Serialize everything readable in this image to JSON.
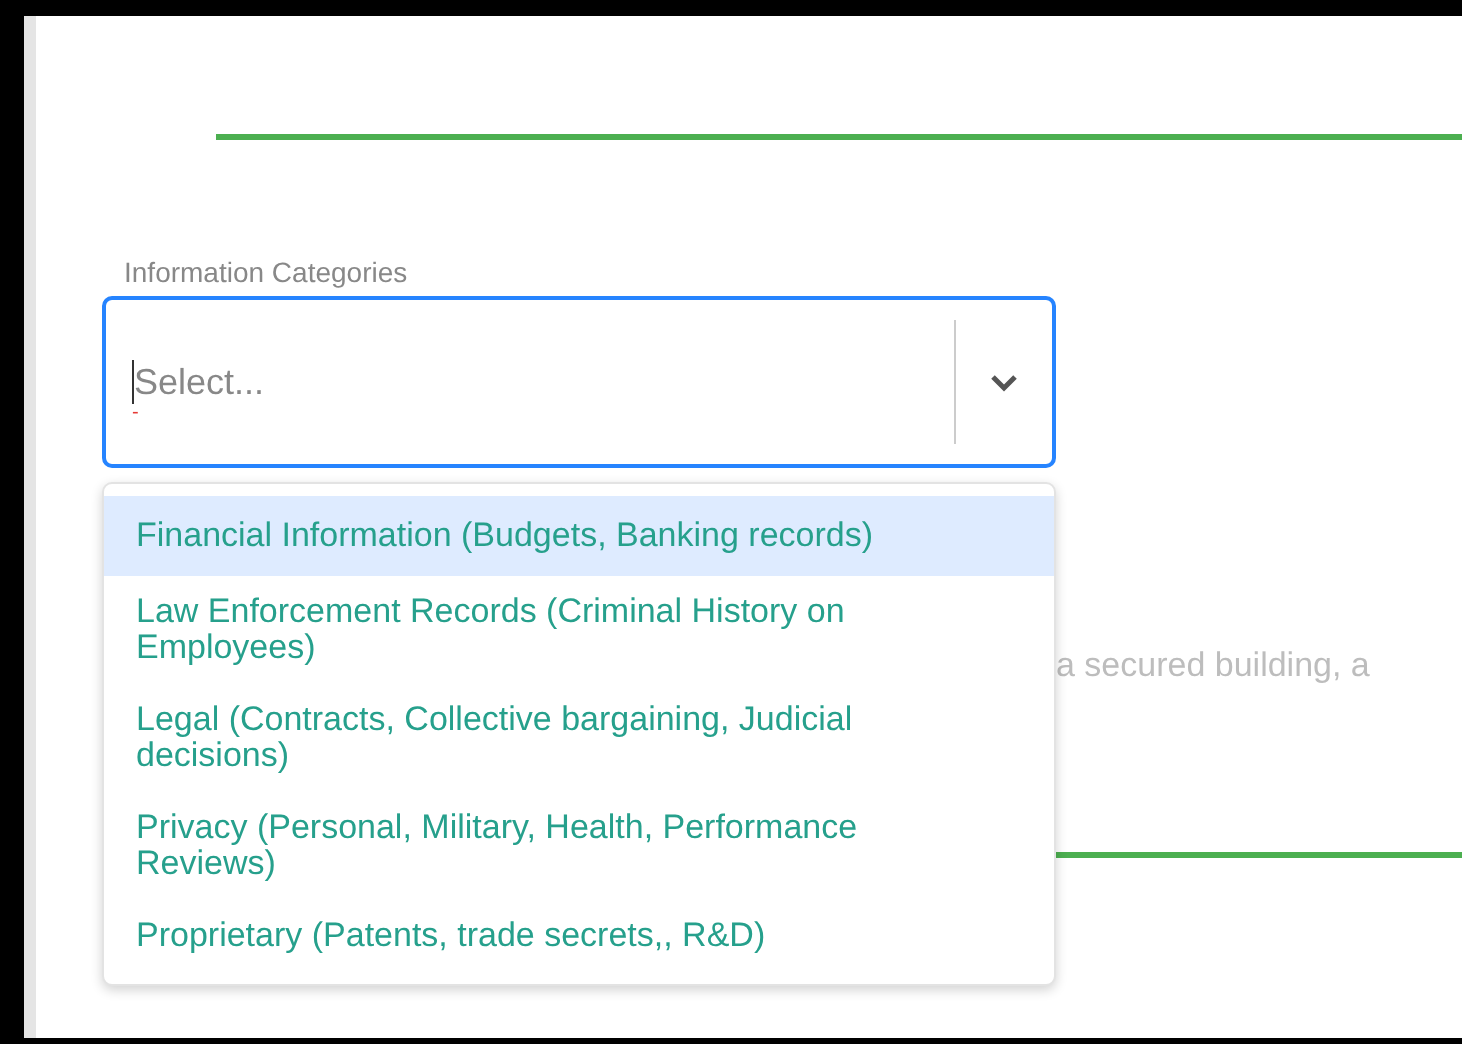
{
  "field": {
    "label": "Information Categories",
    "placeholder": "Select...",
    "focused": true,
    "error_mark": "-",
    "expanded": true
  },
  "options": [
    {
      "label": "Financial Information (Budgets, Banking records)",
      "selected": true
    },
    {
      "label": "Law Enforcement Records (Criminal History on Employees)",
      "selected": false
    },
    {
      "label": "Legal (Contracts, Collective bargaining, Judicial decisions)",
      "selected": false
    },
    {
      "label": "Privacy (Personal, Military, Health, Performance Reviews)",
      "selected": false
    },
    {
      "label": "Proprietary (Patents, trade secrets,, R&D)",
      "selected": false
    }
  ],
  "background_text": "a secured building, a"
}
